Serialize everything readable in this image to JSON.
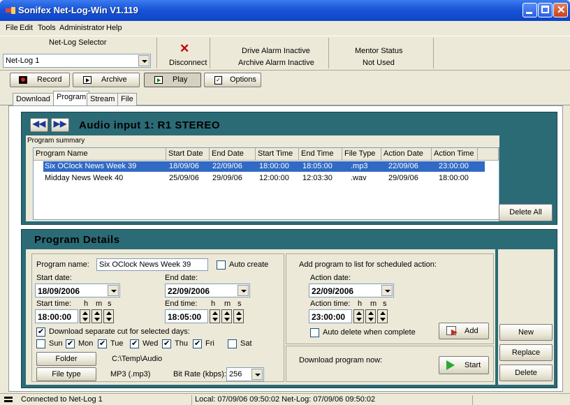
{
  "window": {
    "title": "Sonifex Net-Log-Win V1.119"
  },
  "menu": [
    "File",
    "Edit",
    "Tools",
    "Administrator",
    "Help"
  ],
  "selector": {
    "label": "Net-Log Selector",
    "value": "Net-Log 1"
  },
  "disconnect": {
    "label": "Disconnect"
  },
  "alarms": {
    "drive": "Drive Alarm Inactive",
    "archive": "Archive Alarm Inactive"
  },
  "mentor": {
    "label": "Mentor Status",
    "value": "Not Used"
  },
  "modes": {
    "record": "Record",
    "archive": "Archive",
    "play": "Play",
    "options": "Options"
  },
  "tabs": [
    "Download",
    "Program",
    "Stream",
    "File"
  ],
  "header": {
    "audio_input": "Audio input 1:  R1 STEREO",
    "summary_label": "Program summary"
  },
  "table": {
    "columns": [
      "Program Name",
      "Start Date",
      "End Date",
      "Start Time",
      "End Time",
      "File Type",
      "Action Date",
      "Action Time"
    ],
    "rows": [
      [
        "Six OClock News Week 39",
        "18/09/06",
        "22/09/06",
        "18:00:00",
        "18:05:00",
        ".mp3",
        "22/09/06",
        "23:00:00"
      ],
      [
        "Midday News Week 40",
        "25/09/06",
        "29/09/06",
        "12:00:00",
        "12:03:30",
        ".wav",
        "29/09/06",
        "18:00:00"
      ]
    ]
  },
  "delete_all": "Delete All",
  "details": {
    "title": "Program Details",
    "program_name_label": "Program name:",
    "program_name": "Six OClock News Week 39",
    "auto_create": "Auto create",
    "start_date_label": "Start date:",
    "start_date": "18/09/2006",
    "end_date_label": "End date:",
    "end_date": "22/09/2006",
    "start_time_label": "Start time:",
    "start_time": "18:00:00",
    "end_time_label": "End time:",
    "end_time": "18:05:00",
    "h": "h",
    "m": "m",
    "s": "s",
    "separate_cut": "Download separate cut for selected days:",
    "days": [
      "Sun",
      "Mon",
      "Tue",
      "Wed",
      "Thu",
      "Fri",
      "Sat"
    ],
    "folder_btn": "Folder",
    "folder_path": "C:\\Temp\\Audio",
    "filetype_btn": "File type",
    "filetype": "MP3 (.mp3)",
    "bitrate_label": "Bit Rate (kbps):",
    "bitrate": "256"
  },
  "action": {
    "header": "Add program to list for scheduled action:",
    "date_label": "Action date:",
    "date": "22/09/2006",
    "time_label": "Action time:",
    "time": "23:00:00",
    "auto_delete": "Auto delete when complete",
    "add": "Add",
    "download_now": "Download program now:",
    "start": "Start"
  },
  "side_buttons": {
    "new": "New",
    "replace": "Replace",
    "delete": "Delete"
  },
  "status": {
    "connection": "Connected to Net-Log 1",
    "times": "Local: 07/09/06 09:50:02   Net-Log: 07/09/06 09:50:02"
  }
}
